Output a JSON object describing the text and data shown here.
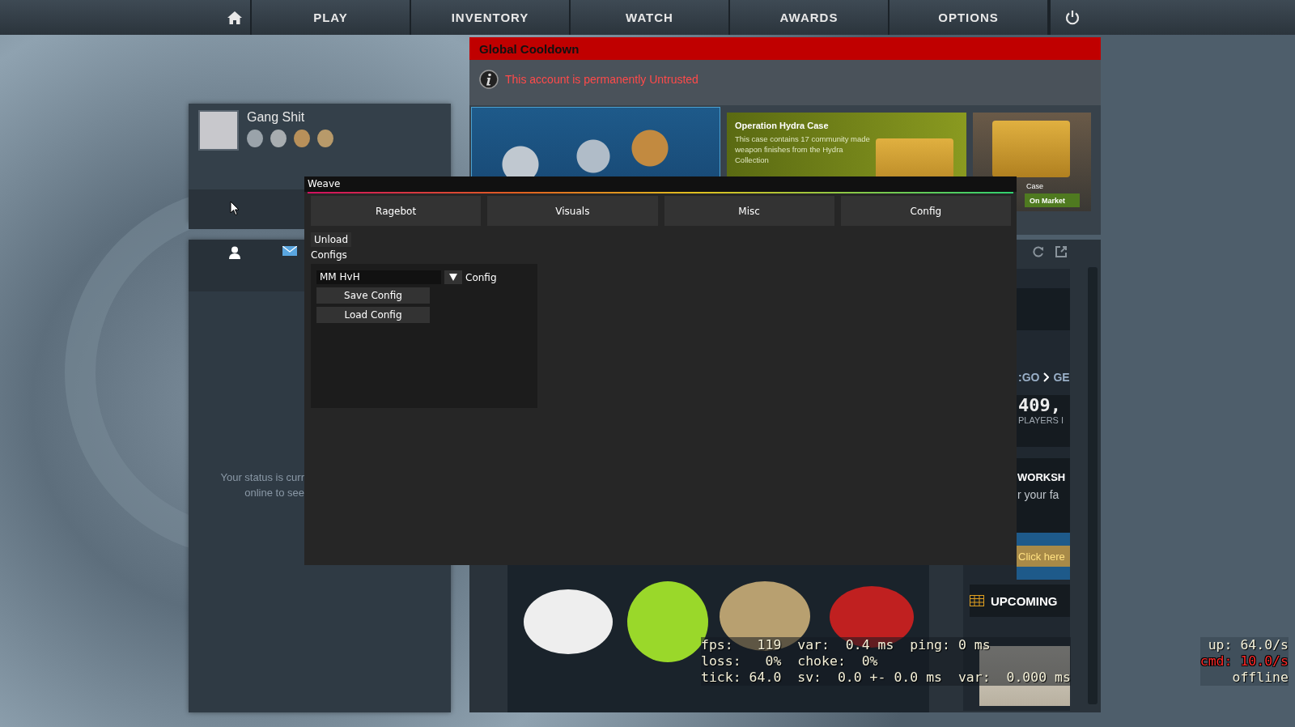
{
  "nav": {
    "items": [
      "PLAY",
      "INVENTORY",
      "WATCH",
      "AWARDS",
      "OPTIONS"
    ]
  },
  "alert": {
    "title": "Global Cooldown",
    "message": "This account is permanently Untrusted"
  },
  "store": {
    "featured": {
      "title": "Operation Hydra Case",
      "description": "This case contains 17 community made weapon finishes from the Hydra Collection"
    },
    "side_item": {
      "label": "Case",
      "button": "On Market"
    }
  },
  "profile": {
    "name": "Gang Shit"
  },
  "friends": {
    "status_lines": [
      "Your status is curr",
      "online to see"
    ]
  },
  "news": {
    "breadcrumb": [
      ":GO",
      "GE"
    ],
    "stat": "409,",
    "stat_label": "PLAYERS I",
    "workshop_title": "WORKSH",
    "workshop_text": "r your fa",
    "promo_button": "Click here",
    "upcoming": "UPCOMING"
  },
  "weave": {
    "title": "Weave",
    "tabs": [
      {
        "label": "Ragebot",
        "selected": false
      },
      {
        "label": "Visuals",
        "selected": false
      },
      {
        "label": "Misc",
        "selected": false
      },
      {
        "label": "Config",
        "selected": false
      }
    ],
    "unload": "Unload",
    "section": "Configs",
    "config_select": {
      "value": "MM HvH",
      "label": "Config"
    },
    "buttons": [
      "Save Config",
      "Load Config"
    ]
  },
  "netgraph": {
    "lines": [
      "fps:   119  var:  0.4 ms  ping: 0 ms",
      "loss:   0%  choke:  0%",
      "tick: 64.0  sv:  0.0 +- 0.0 ms  var:  0.000 ms"
    ],
    "right": [
      {
        "text": "up: 64.0/s",
        "kind": "normal"
      },
      {
        "text": "cmd: 10.0/s",
        "kind": "warning"
      },
      {
        "text": "offline",
        "kind": "normal"
      }
    ]
  }
}
